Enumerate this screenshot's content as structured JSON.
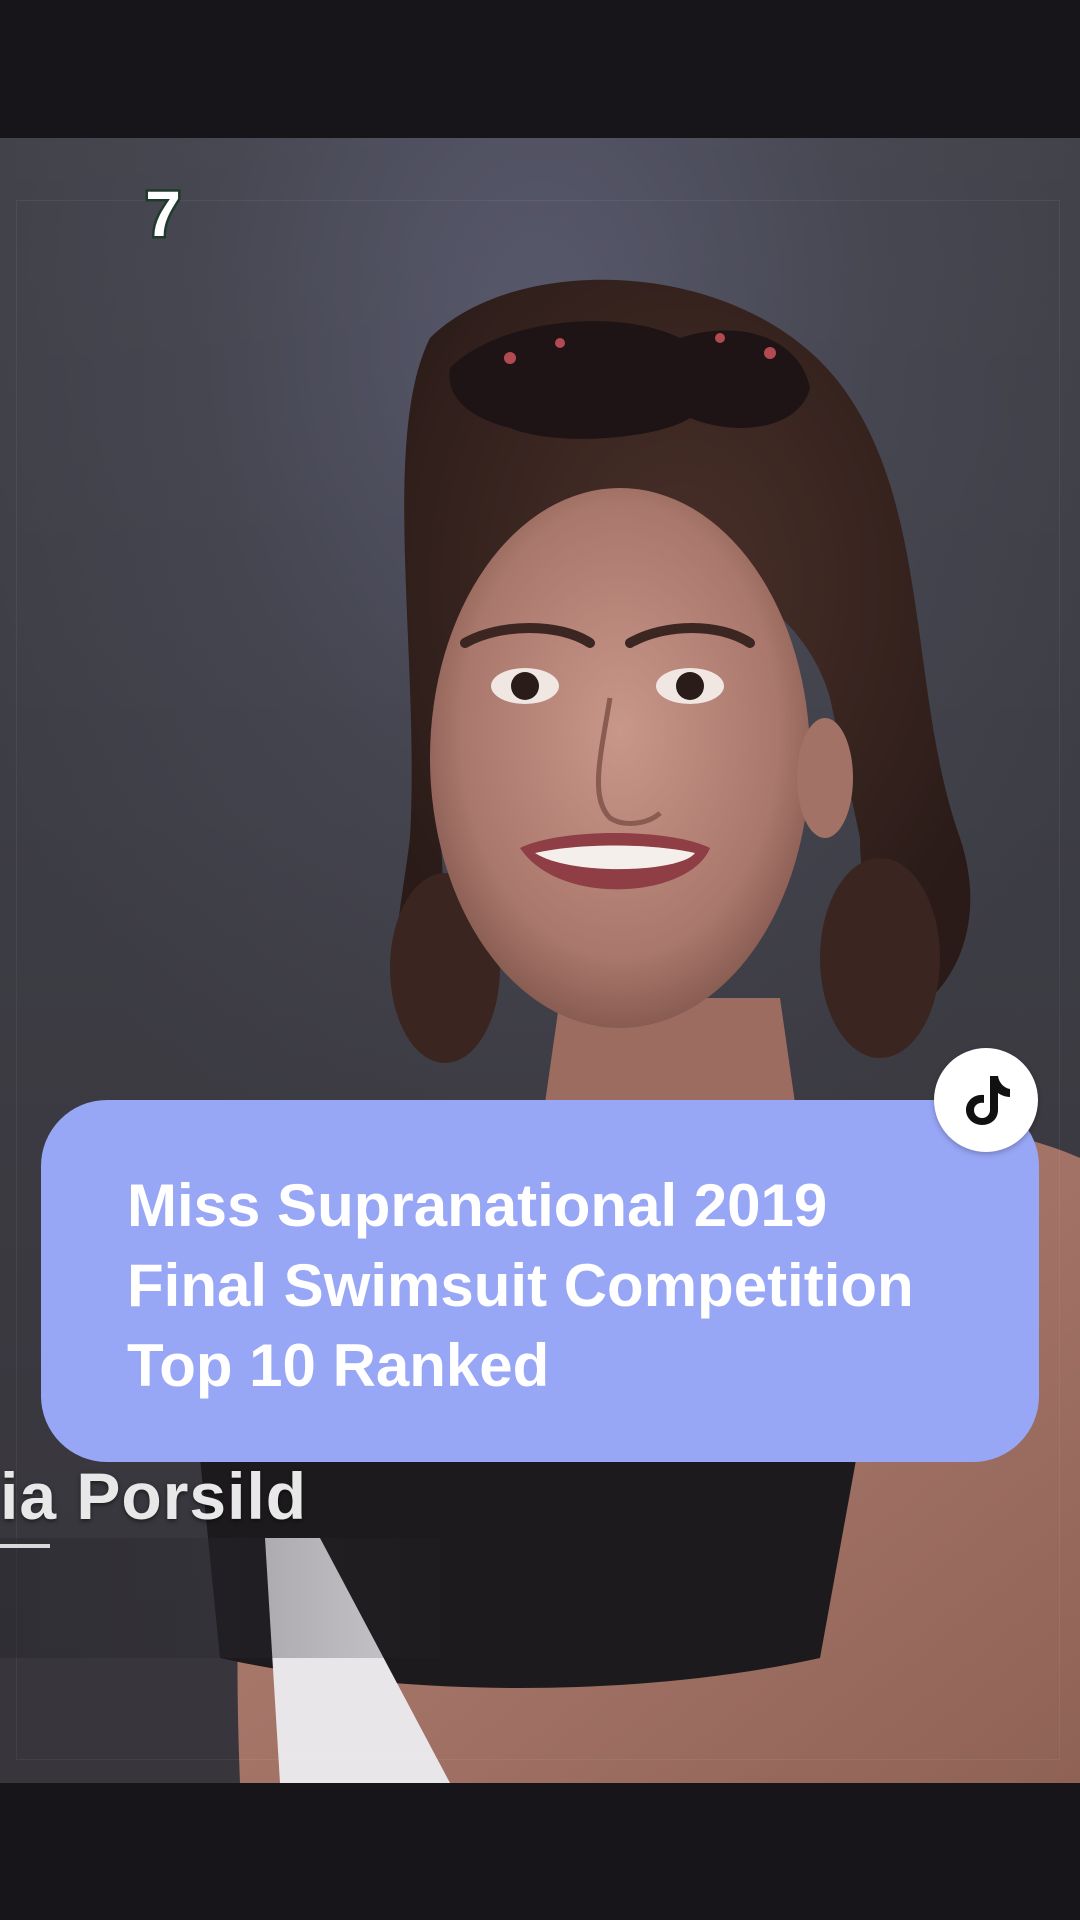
{
  "video": {
    "channel_logo_text": "7",
    "lower_third_name": "ia Porsild"
  },
  "caption": {
    "lines": [
      "Miss Supranational 2019",
      "Final Swimsuit Competition",
      "Top 10 Ranked"
    ]
  },
  "icons": {
    "tiktok_badge": "tiktok-logo-icon",
    "channel_logo": "channel-7-logo-icon"
  },
  "colors": {
    "caption_background": "#98a6f6",
    "caption_text": "#ffffff",
    "letterbox": "#17141a"
  }
}
